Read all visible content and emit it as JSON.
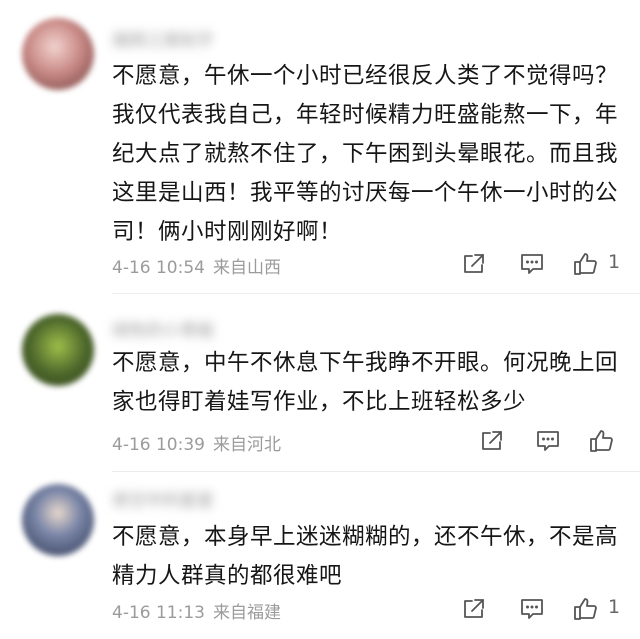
{
  "comments": [
    {
      "username": "烟雨江南知乎",
      "text": "不愿意，午休一个小时已经很反人类了不觉得吗？我仅代表我自己，年轻时候精力旺盛能熬一下，年纪大点了就熬不住了，下午困到头晕眼花。而且我这里是山西！我平等的讨厌每一个午休一小时的公司！俩小时刚刚好啊！",
      "time": "4-16 10:54",
      "location": "来自山西",
      "like_count": "1",
      "avatar_color": "#c98a86"
    },
    {
      "username": "绿色的小青蛙",
      "text": "不愿意，中午不休息下午我睁不开眼。何况晚上回家也得盯着娃写作业，不比上班轻松多少",
      "time": "4-16 10:39",
      "location": "来自河北",
      "like_count": "",
      "avatar_color": "#4f6a2c"
    },
    {
      "username": "夜空中的星星",
      "text": "不愿意，本身早上迷迷糊糊的，还不午休，不是高精力人群真的都很难吧",
      "time": "4-16 11:13",
      "location": "来自福建",
      "like_count": "1",
      "avatar_color": "#3f4a66"
    }
  ],
  "icons": {
    "share": "share-icon",
    "reply": "comment-icon",
    "like": "thumbs-up-icon"
  }
}
